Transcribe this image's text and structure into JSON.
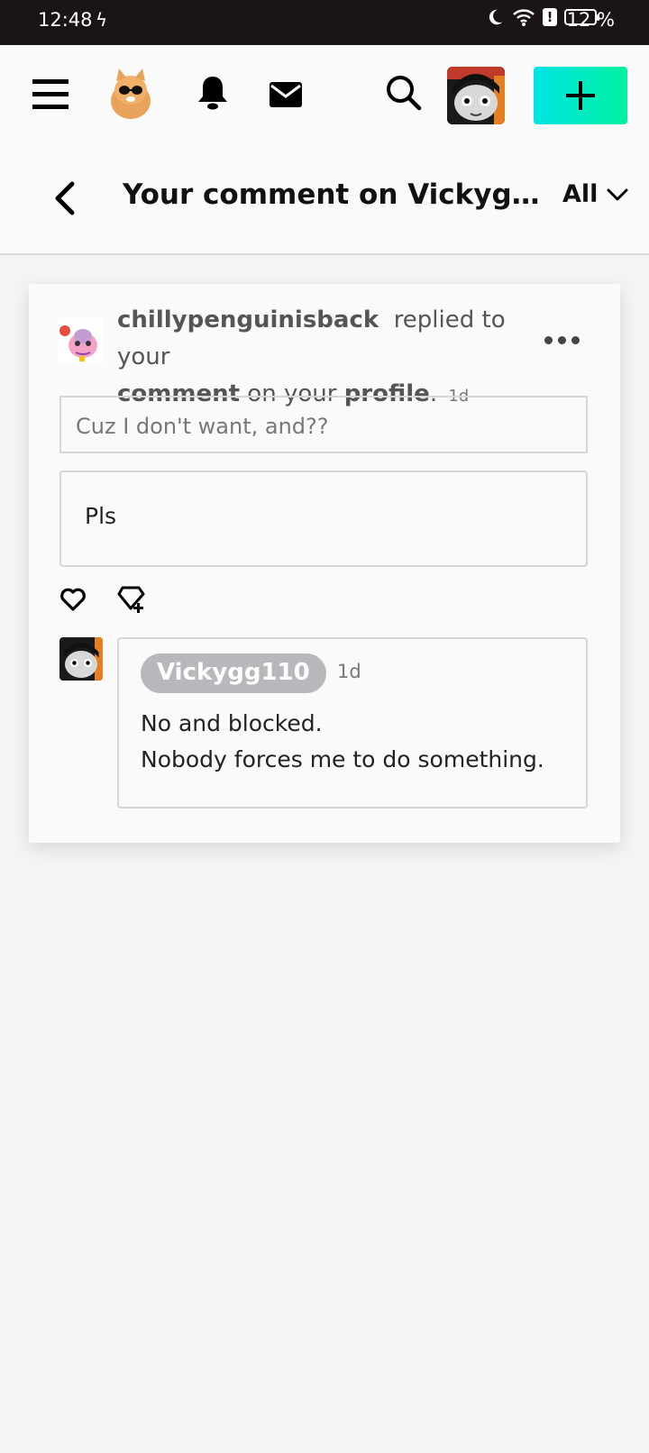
{
  "status": {
    "time": "12:48",
    "battery": "12 %"
  },
  "header": {
    "icons": [
      "menu-icon",
      "cat-avatar",
      "bell-icon",
      "mail-icon",
      "search-icon",
      "user-avatar",
      "plus-icon"
    ]
  },
  "title_bar": {
    "title": "Your comment on Vickygg110's profile",
    "filter": "All"
  },
  "notification": {
    "sender": "chillypenguinisback",
    "action": "replied to your",
    "comment_word": "comment",
    "mid": "on your",
    "profile_word": "profile",
    "time": "1d",
    "quoted_text": "Cuz I don't want, and??",
    "reply_text": "Pls"
  },
  "my_reply": {
    "username": "Vickygg110",
    "time": "1d",
    "line1": "No and blocked.",
    "line2": "Nobody forces me to do something."
  },
  "colors": {
    "accent_start": "#00e5e5",
    "accent_end": "#00f0a0",
    "status_bar": "#1a1418"
  }
}
